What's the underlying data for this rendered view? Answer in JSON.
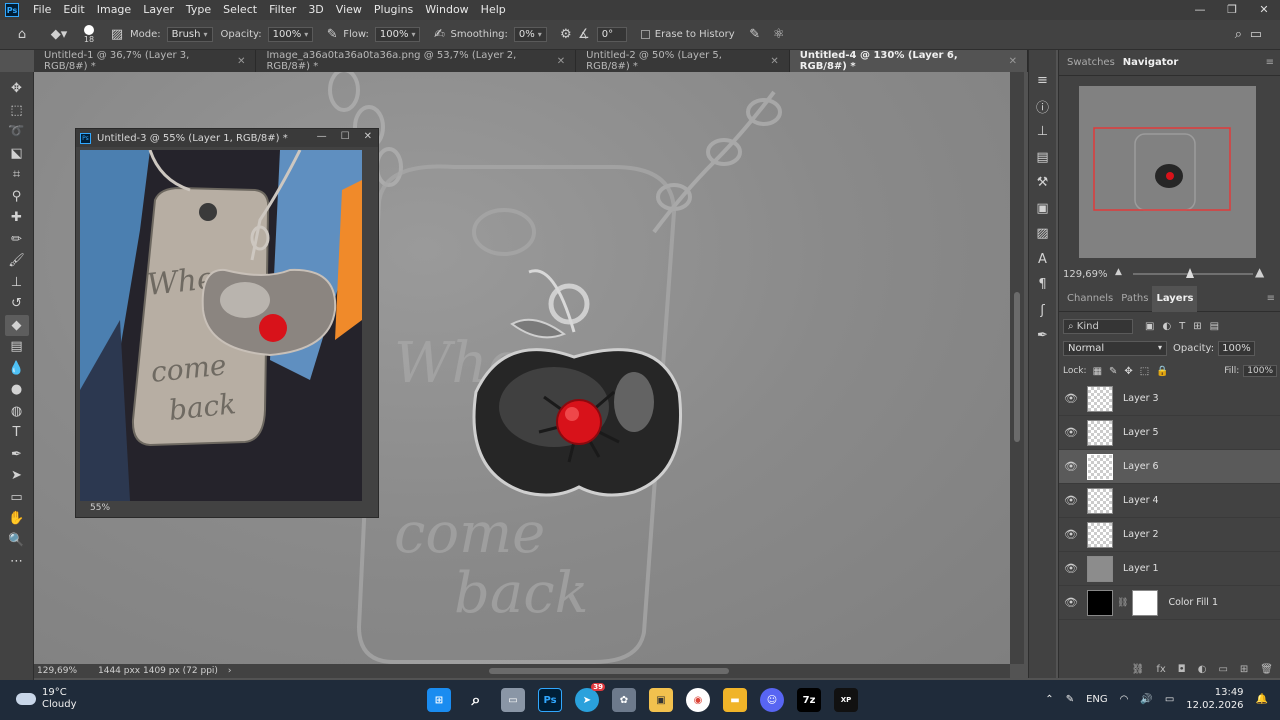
{
  "app": {
    "logo": "Ps",
    "menu": [
      "File",
      "Edit",
      "Image",
      "Layer",
      "Type",
      "Select",
      "Filter",
      "3D",
      "View",
      "Plugins",
      "Window",
      "Help"
    ],
    "window_controls": [
      "—",
      "❐",
      "✕"
    ]
  },
  "options": {
    "brush_size": "18",
    "mode_label": "Mode:",
    "mode_value": "Brush",
    "opacity_label": "Opacity:",
    "opacity_value": "100%",
    "flow_label": "Flow:",
    "flow_value": "100%",
    "smoothing_label": "Smoothing:",
    "smoothing_value": "0%",
    "angle_value": "0°",
    "erase_history_label": "Erase to History"
  },
  "tabs": [
    {
      "label": "Untitled-1 @ 36,7% (Layer 3, RGB/8#) *"
    },
    {
      "label": "Image_a36a0ta36a0ta36a.png @ 53,7% (Layer 2, RGB/8#) *"
    },
    {
      "label": "Untitled-2 @ 50% (Layer 5, RGB/8#) *"
    },
    {
      "label": "Untitled-4 @ 130% (Layer 6, RGB/8#) *"
    }
  ],
  "canvas": {
    "zoom": "129,69%",
    "doc_info": "1444 pxx 1409 px (72 ppi)",
    "sketch_text": [
      "Whe",
      "come",
      "back"
    ]
  },
  "floating_window": {
    "title": "Untitled-3 @ 55% (Layer 1, RGB/8#) *",
    "zoom": "55%",
    "photo_text": [
      "Whe",
      "come",
      "back"
    ]
  },
  "navigator": {
    "tabs": [
      "Swatches",
      "Navigator"
    ],
    "zoom": "129,69%"
  },
  "layers_panel": {
    "tabs": [
      "Channels",
      "Paths",
      "Layers"
    ],
    "kind_label": "Kind",
    "blend_mode": "Normal",
    "opacity_label": "Opacity:",
    "opacity_value": "100%",
    "lock_label": "Lock:",
    "fill_label": "Fill:",
    "fill_value": "100%",
    "layers": [
      {
        "name": "Layer 3"
      },
      {
        "name": "Layer 5"
      },
      {
        "name": "Layer 6"
      },
      {
        "name": "Layer 4"
      },
      {
        "name": "Layer 2"
      },
      {
        "name": "Layer 1"
      },
      {
        "name": "Color Fill 1"
      }
    ]
  },
  "taskbar": {
    "temperature": "19°C",
    "weather": "Cloudy",
    "telegram_badge": "39",
    "lang": "ENG",
    "time": "13:49",
    "date": "12.02.2026",
    "apps": [
      "start",
      "search",
      "task-view",
      "photoshop",
      "telegram",
      "paint",
      "explorer-cat",
      "chrome",
      "file-explorer",
      "discord",
      "7zip",
      "xp-pen"
    ]
  },
  "colors": {
    "accent": "#31a8ff",
    "gem": "#d8121a",
    "selection_rect": "#e03a3a"
  }
}
